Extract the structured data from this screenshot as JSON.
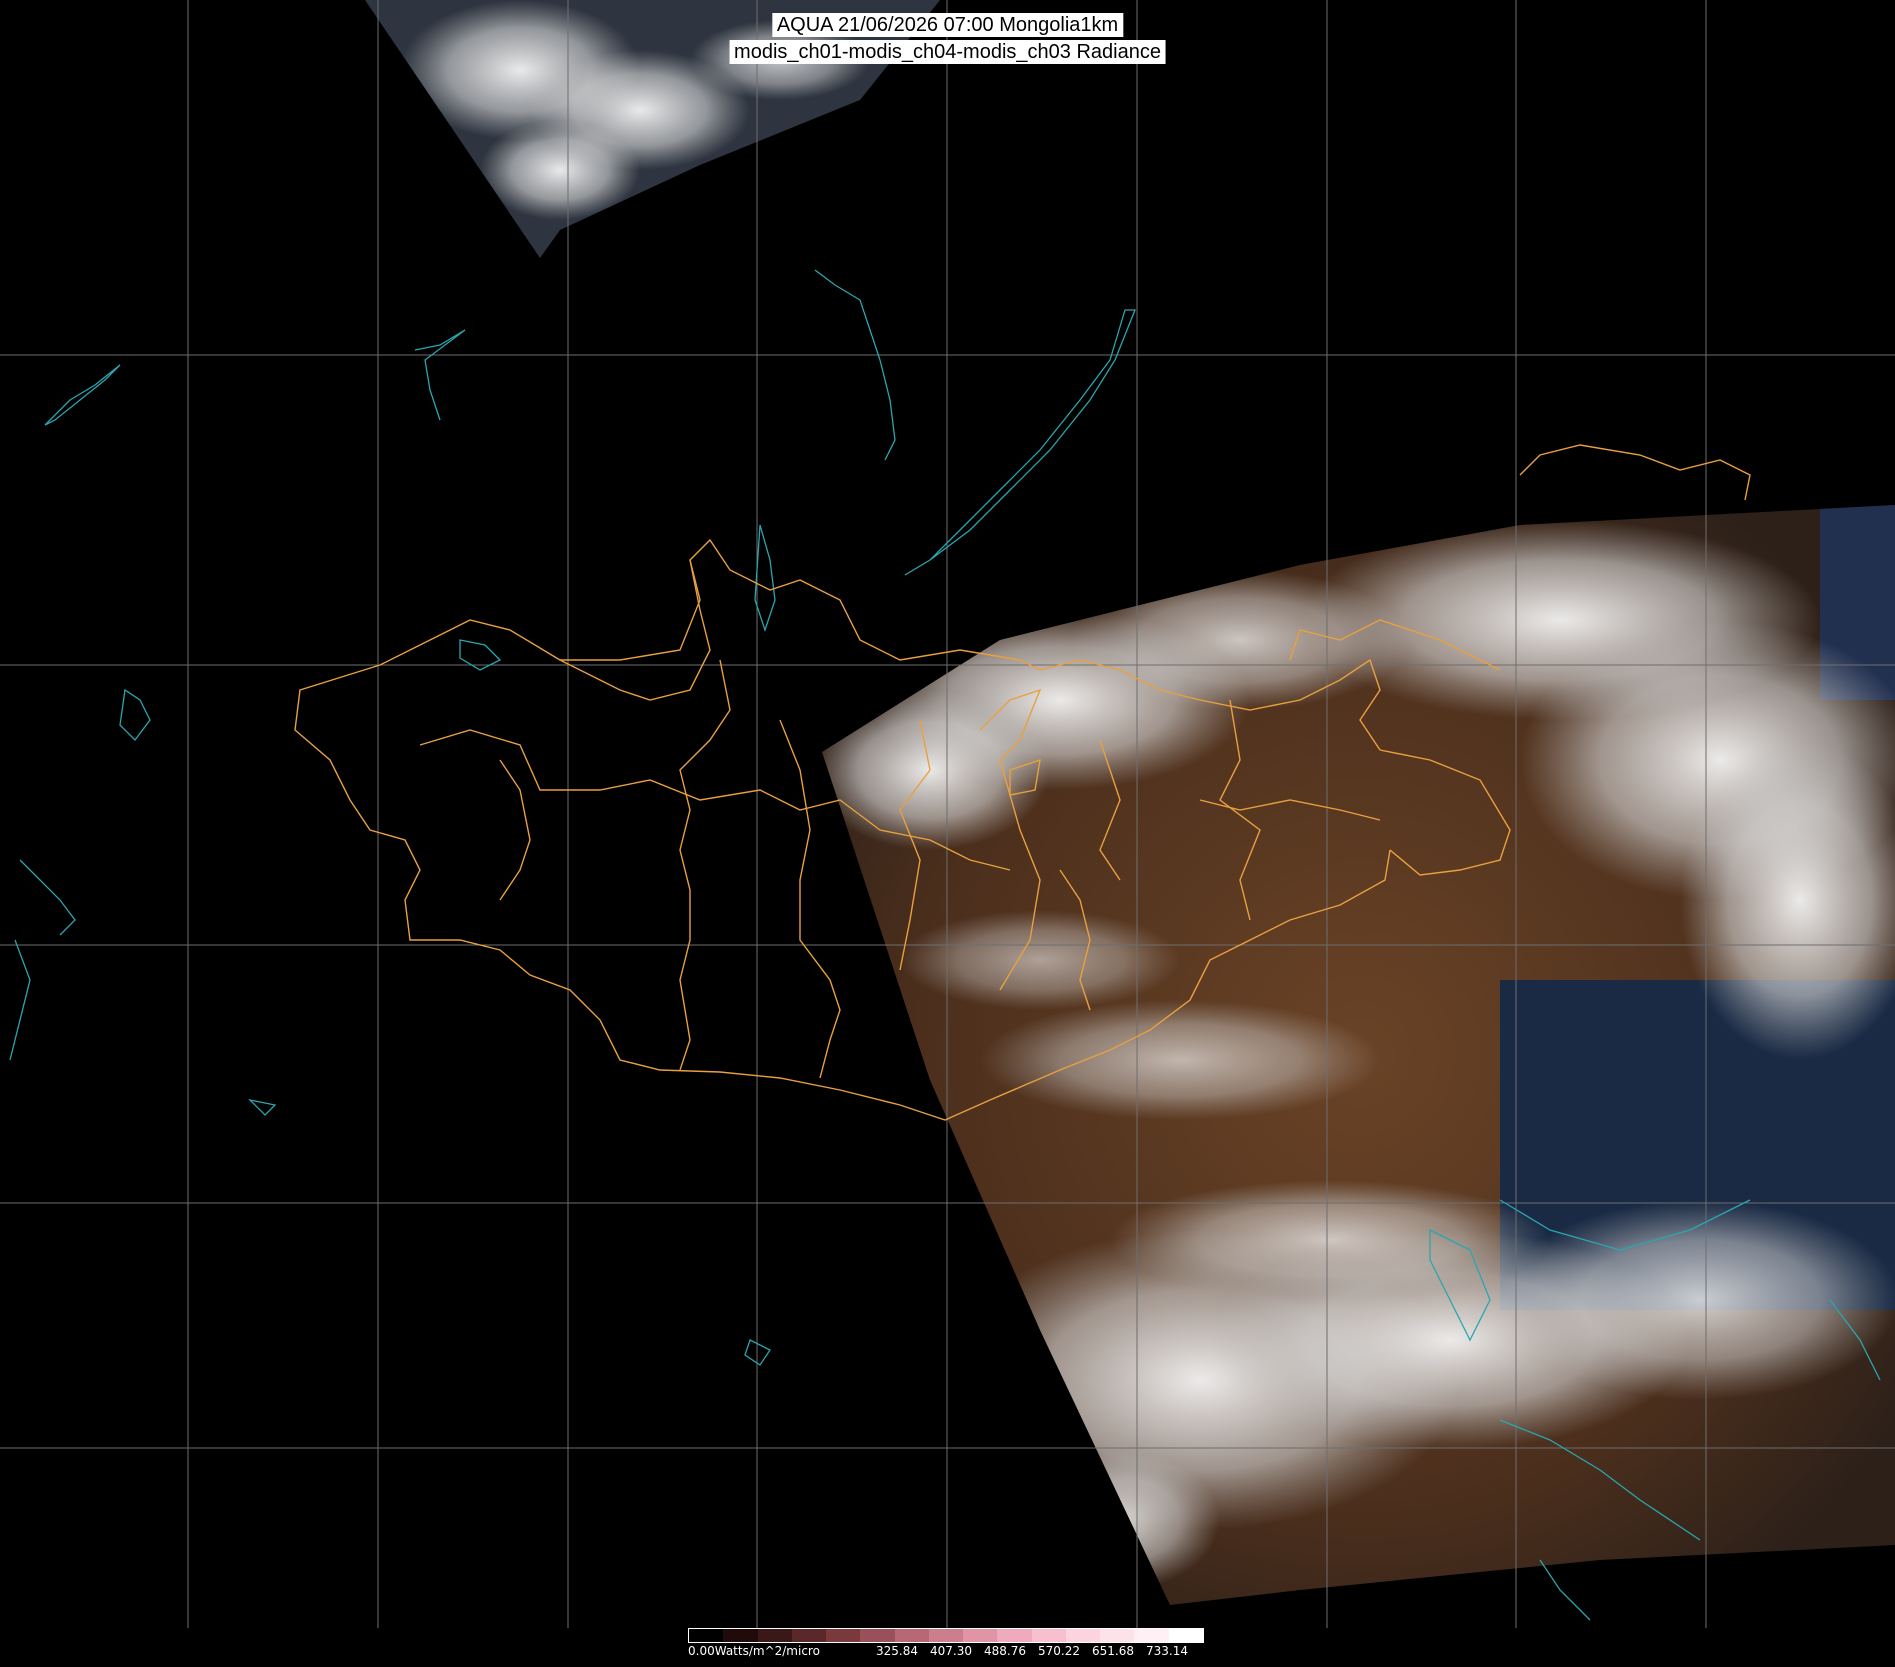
{
  "header": {
    "line1": "AQUA 21/06/2026 07:00 Mongolia1km",
    "line2": "modis_ch01-modis_ch04-modis_ch03 Radiance"
  },
  "colors": {
    "background": "#000000",
    "grid": "#6e6e6e",
    "boundaries": "#e8a040",
    "coastlines": "#2aa6b0",
    "title_box": "#ffffff"
  },
  "legend": {
    "min_label": "0.00Watts/m^2/micro",
    "ticks": [
      "325.84",
      "407.30",
      "488.76",
      "570.22",
      "651.68",
      "733.14"
    ],
    "range": [
      0,
      814.6
    ],
    "colors": [
      "#000000",
      "#200a0a",
      "#3a1818",
      "#5a2828",
      "#7a3a3c",
      "#9a5058",
      "#b86872",
      "#cc7e8c",
      "#e094a6",
      "#f0aabd",
      "#f8c0cf",
      "#fcd4e0",
      "#fde2ea",
      "#fef0f4",
      "#ffffff"
    ]
  }
}
